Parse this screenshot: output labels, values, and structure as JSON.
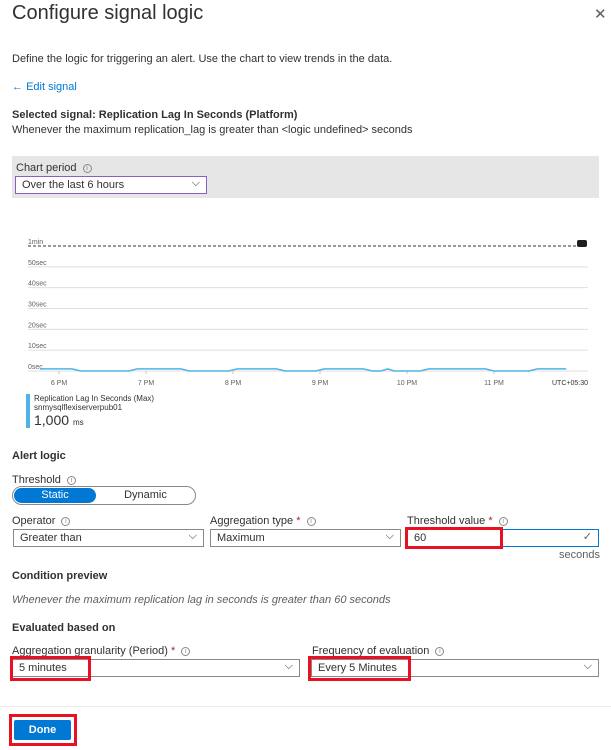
{
  "header": {
    "title": "Configure signal logic",
    "close_icon": "close-icon"
  },
  "description": "Define the logic for triggering an alert. Use the chart to view trends in the data.",
  "edit_signal": "Edit signal",
  "selected_signal": "Selected signal: Replication Lag In Seconds (Platform)",
  "signal_condition": "Whenever the maximum replication_lag is greater than <logic undefined> seconds",
  "chart_period": {
    "label": "Chart period",
    "value": "Over the last 6 hours"
  },
  "chart_data": {
    "type": "line",
    "y_ticks": [
      "0sec",
      "10sec",
      "20sec",
      "30sec",
      "40sec",
      "50sec",
      "1min"
    ],
    "ylim": [
      0,
      60
    ],
    "threshold": 60,
    "x_ticks": [
      {
        "label": "6 PM",
        "h": 18
      },
      {
        "label": "7 PM",
        "h": 19
      },
      {
        "label": "8 PM",
        "h": 20
      },
      {
        "label": "9 PM",
        "h": 21
      },
      {
        "label": "10 PM",
        "h": 22
      },
      {
        "label": "11 PM",
        "h": 23
      }
    ],
    "timezone": "UTC+05:30",
    "series": [
      {
        "name": "Replication Lag In Seconds (Max)",
        "resource": "snmysqlflexiserverpub01",
        "color": "#4fb3e8",
        "x": [
          17.78,
          18.15,
          18.25,
          18.8,
          18.9,
          19.4,
          19.5,
          19.95,
          20.05,
          20.5,
          20.6,
          20.95,
          21.05,
          21.5,
          21.6,
          21.7,
          21.78,
          21.85,
          22.15,
          22.25,
          22.9,
          23.0,
          23.4,
          23.5,
          23.83
        ],
        "y": [
          1,
          1,
          0,
          0,
          1,
          1,
          0,
          0,
          1,
          1,
          0,
          0,
          1,
          1,
          0,
          0,
          1,
          0,
          0,
          1,
          1,
          0,
          0,
          1,
          1
        ]
      }
    ],
    "legend_value": "1,000",
    "legend_unit": "ms"
  },
  "alert_logic": {
    "title": "Alert logic",
    "threshold_label": "Threshold",
    "threshold_options": [
      "Static",
      "Dynamic"
    ],
    "operator": {
      "label": "Operator",
      "value": "Greater than"
    },
    "aggregation": {
      "label": "Aggregation type",
      "required": "*",
      "value": "Maximum"
    },
    "threshold_value": {
      "label": "Threshold value",
      "required": "*",
      "value": "60",
      "unit": "seconds"
    }
  },
  "condition_preview": {
    "title": "Condition preview",
    "text": "Whenever the maximum replication lag in seconds is greater than 60 seconds"
  },
  "evaluated": {
    "title": "Evaluated based on",
    "granularity": {
      "label": "Aggregation granularity (Period)",
      "required": "*",
      "value": "5 minutes"
    },
    "frequency": {
      "label": "Frequency of evaluation",
      "value": "Every 5 Minutes"
    }
  },
  "footer": {
    "done": "Done"
  },
  "colors": {
    "accent": "#0078d4",
    "highlight": "#e81123"
  }
}
